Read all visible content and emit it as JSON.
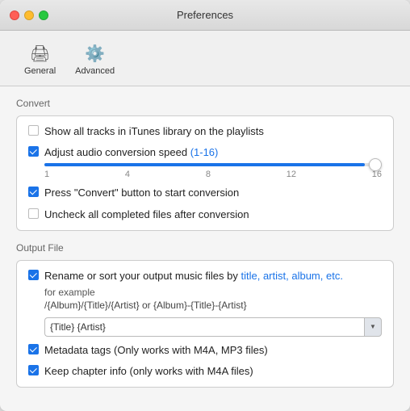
{
  "window": {
    "title": "Preferences"
  },
  "toolbar": {
    "items": [
      {
        "id": "general",
        "label": "General",
        "icon": "🖨"
      },
      {
        "id": "advanced",
        "label": "Advanced",
        "icon": "⚙️"
      }
    ]
  },
  "convert_section": {
    "label": "Convert",
    "options": [
      {
        "id": "show-all-tracks",
        "checked": false,
        "text": "Show all tracks in iTunes library on the playlists"
      },
      {
        "id": "adjust-audio-speed",
        "checked": true,
        "text": "Adjust audio conversion speed (1-16)"
      },
      {
        "id": "press-convert",
        "checked": true,
        "text": "Press \"Convert\" button to start conversion"
      },
      {
        "id": "uncheck-completed",
        "checked": false,
        "text": "Uncheck all completed files after conversion"
      }
    ],
    "slider": {
      "min": 1,
      "max": 16,
      "value": 16,
      "ticks": [
        "1",
        "4",
        "8",
        "12",
        "16"
      ]
    }
  },
  "output_section": {
    "label": "Output File",
    "rename_checked": true,
    "rename_label": "Rename or sort your output music files by ",
    "rename_label_highlight": "title, artist, album, etc.",
    "for_example_label": "for example",
    "template_text": "/{Album}/{Title}/{Artist} or {Album}-{Title}-{Artist}",
    "input_value": "{Title} {Artist}",
    "metadata_checked": true,
    "metadata_label": "Metadata tags (Only works with M4A, MP3 files)",
    "chapter_checked": true,
    "chapter_label": "Keep chapter info (only works with  M4A files)"
  }
}
